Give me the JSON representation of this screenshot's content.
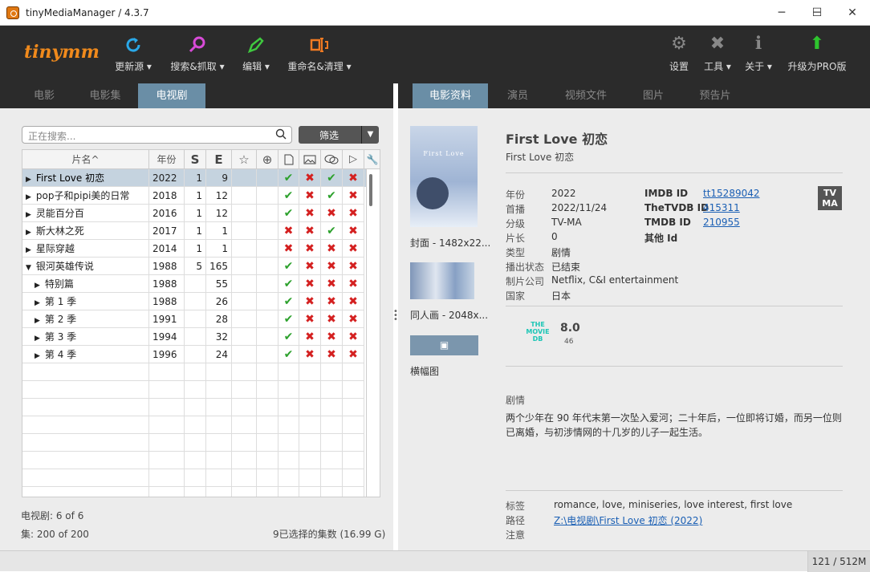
{
  "window": {
    "title": "tinyMediaManager / 4.3.7",
    "minimize": "─",
    "maximize": "☐",
    "close": "✕"
  },
  "toolbar": {
    "logo": "tinymm",
    "items": [
      {
        "label": "更新源 ▾"
      },
      {
        "label": "搜索&抓取 ▾"
      },
      {
        "label": "编辑 ▾"
      },
      {
        "label": "重命名&清理 ▾"
      },
      {
        "label": "设置"
      },
      {
        "label": "工具 ▾"
      },
      {
        "label": "关于 ▾"
      },
      {
        "label": "升级为PRO版"
      }
    ]
  },
  "left_tabs": [
    "电影",
    "电影集",
    "电视剧"
  ],
  "right_tabs": [
    "电影资料",
    "演员",
    "视频文件",
    "图片",
    "预告片"
  ],
  "search": {
    "placeholder": "正在搜索..."
  },
  "filter": {
    "label": "筛选"
  },
  "table": {
    "headers": [
      "片名^",
      "年份",
      "S",
      "E"
    ],
    "rows": [
      {
        "name": "First Love 初恋",
        "year": "2022",
        "s": "1",
        "e": "9",
        "flags": [
          1,
          0,
          1,
          0
        ],
        "level": 0,
        "expander": "▶",
        "selected": true
      },
      {
        "name": "pop子和pipi美的日常",
        "year": "2018",
        "s": "1",
        "e": "12",
        "flags": [
          1,
          0,
          1,
          0
        ],
        "level": 0,
        "expander": "▶"
      },
      {
        "name": "灵能百分百",
        "year": "2016",
        "s": "1",
        "e": "12",
        "flags": [
          1,
          0,
          0,
          0
        ],
        "level": 0,
        "expander": "▶"
      },
      {
        "name": "斯大林之死",
        "year": "2017",
        "s": "1",
        "e": "1",
        "flags": [
          0,
          0,
          1,
          0
        ],
        "level": 0,
        "expander": "▶"
      },
      {
        "name": "星际穿越",
        "year": "2014",
        "s": "1",
        "e": "1",
        "flags": [
          0,
          0,
          0,
          0
        ],
        "level": 0,
        "expander": "▶"
      },
      {
        "name": "银河英雄传说",
        "year": "1988",
        "s": "5",
        "e": "165",
        "flags": [
          1,
          0,
          0,
          0
        ],
        "level": 0,
        "expander": "▼"
      },
      {
        "name": "特别篇",
        "year": "1988",
        "s": "",
        "e": "55",
        "flags": [
          1,
          0,
          0,
          0
        ],
        "level": 1,
        "expander": "▶"
      },
      {
        "name": "第 1 季",
        "year": "1988",
        "s": "",
        "e": "26",
        "flags": [
          1,
          0,
          0,
          0
        ],
        "level": 1,
        "expander": "▶"
      },
      {
        "name": "第 2 季",
        "year": "1991",
        "s": "",
        "e": "28",
        "flags": [
          1,
          0,
          0,
          0
        ],
        "level": 1,
        "expander": "▶"
      },
      {
        "name": "第 3 季",
        "year": "1994",
        "s": "",
        "e": "32",
        "flags": [
          1,
          0,
          0,
          0
        ],
        "level": 1,
        "expander": "▶"
      },
      {
        "name": "第 4 季",
        "year": "1996",
        "s": "",
        "e": "24",
        "flags": [
          1,
          0,
          0,
          0
        ],
        "level": 1,
        "expander": "▶"
      }
    ]
  },
  "stats": {
    "tvshows": "电视剧:  6   of   6",
    "episodes": "集:  200   of   200",
    "selected": "9已选择的集数 (16.99 G)"
  },
  "artwork": {
    "poster_text": "First Love",
    "poster_caption": "封面 - 1482x22...",
    "fanart_caption": "同人画 - 2048x...",
    "banner_caption": "横幅图"
  },
  "details": {
    "title": "First Love 初恋",
    "original_title": "First Love 初恋",
    "fields": [
      {
        "label": "年份",
        "value": "2022"
      },
      {
        "label": "首播",
        "value": "2022/11/24"
      },
      {
        "label": "分级",
        "value": "TV-MA"
      },
      {
        "label": "片长",
        "value": "0"
      },
      {
        "label": "类型",
        "value": "剧情"
      },
      {
        "label": "播出状态",
        "value": "已结束"
      },
      {
        "label": "制片公司",
        "value": "Netflix, C&I entertainment"
      },
      {
        "label": "国家",
        "value": "日本"
      }
    ],
    "ids": [
      {
        "label": "IMDB ID",
        "value": "tt15289042"
      },
      {
        "label": "TheTVDB ID",
        "value": "415311"
      },
      {
        "label": "TMDB ID",
        "value": "210955"
      },
      {
        "label": "其他 Id",
        "value": ""
      }
    ],
    "cert_badge": "TV MA",
    "tmdb_logo": "THE MOVIE DB",
    "rating": "8.0",
    "votes": "46",
    "plot_label": "剧情",
    "plot": "两个少年在 90 年代末第一次坠入爱河；二十年后，一位即将订婚，而另一位则已离婚，与初涉情网的十几岁的儿子一起生活。",
    "tags_label": "标签",
    "tags": "romance, love, miniseries, love interest, first love",
    "path_label": "路径",
    "path": "Z:\\电视剧\\First Love 初恋 (2022)",
    "note_label": "注意"
  },
  "memory": "121 / 512M",
  "colors": {
    "accent": "#6a8ea6",
    "toolbar": "#2b2b2b",
    "logo": "#f08a1c",
    "ok": "#2da12d",
    "no": "#d42020"
  }
}
